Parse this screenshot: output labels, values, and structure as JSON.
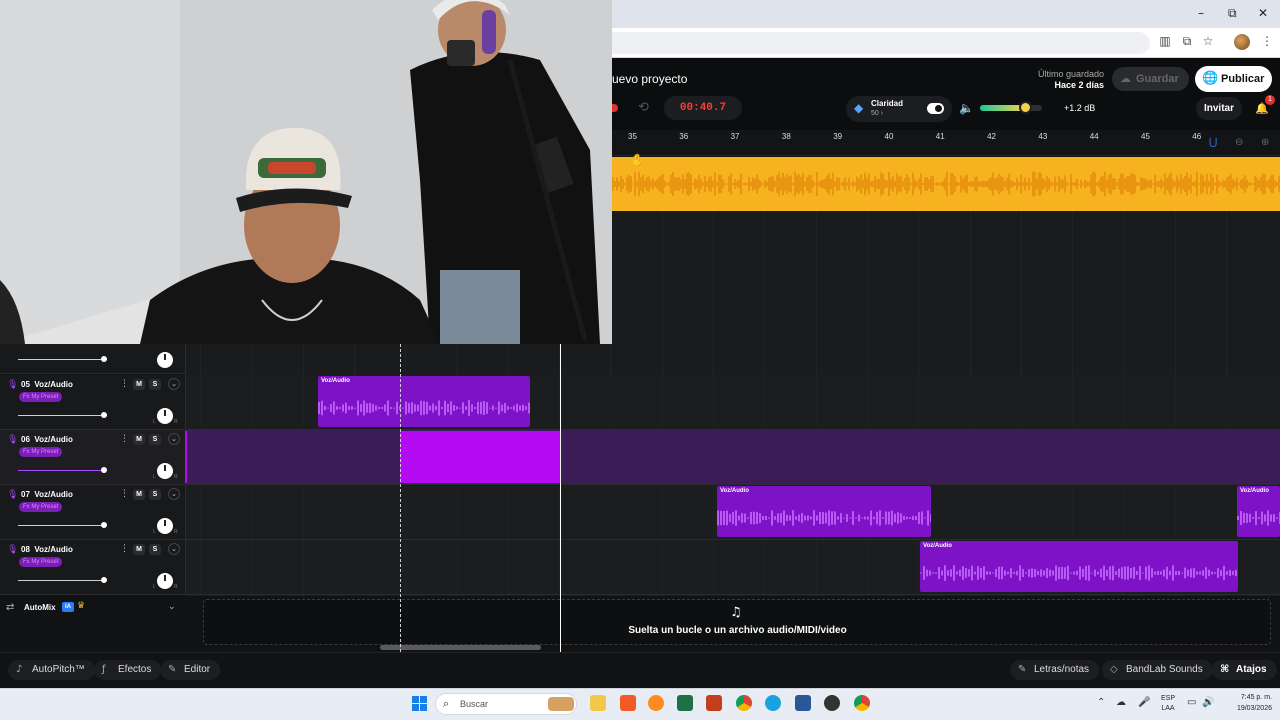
{
  "browser": {
    "minimize": "–",
    "restore": "⧉",
    "close": "✕"
  },
  "header": {
    "project_title": "uevo proyecto",
    "last_saved_label": "Último guardado",
    "last_saved_value": "Hace 2 días",
    "save_label": "Guardar",
    "publish_label": "Publicar",
    "time": "00:40.7",
    "clarity_label": "Claridad",
    "clarity_value": "50 ›",
    "volume_level": 0.73,
    "gain": "+1.2 dB",
    "invite_label": "Invitar",
    "notifications": "1"
  },
  "ruler": {
    "bars": [
      "35",
      "36",
      "37",
      "38",
      "39",
      "40",
      "41",
      "42",
      "43",
      "44",
      "45",
      "46"
    ]
  },
  "tracks": [
    {
      "number": "05",
      "name": "Voz/Audio",
      "fx": "Fx  My Preset",
      "mute": "M",
      "solo": "S",
      "volume": 0.98,
      "active": false,
      "clip_label": "Voz/Audio"
    },
    {
      "number": "06",
      "name": "Voz/Audio",
      "fx": "Fx  My Preset",
      "mute": "M",
      "solo": "S",
      "volume": 0.98,
      "active": true
    },
    {
      "number": "07",
      "name": "Voz/Audio",
      "fx": "Fx  My Preset",
      "mute": "M",
      "solo": "S",
      "volume": 0.98,
      "active": false,
      "clip_label": "Voz/Audio",
      "clip2_label": "Voz/Audio"
    },
    {
      "number": "08",
      "name": "Voz/Audio",
      "fx": "Fx  My Preset",
      "mute": "M",
      "solo": "S",
      "volume": 0.98,
      "active": false,
      "clip_label": "Voz/Audio"
    }
  ],
  "pan": {
    "left": "L",
    "right": "R"
  },
  "automix": {
    "label": "AutoMix",
    "badge": "IA"
  },
  "dropzone": {
    "text": "Suelta un bucle o un archivo audio/MIDI/video"
  },
  "toolbar": {
    "autopitch": "AutoPitch™",
    "effects": "Efectos",
    "editor": "Editor",
    "lyrics": "Letras/notas",
    "sounds": "BandLab Sounds",
    "shortcuts": "Atajos"
  },
  "taskbar": {
    "search_placeholder": "Buscar",
    "lang_top": "ESP",
    "lang_bottom": "LAA",
    "time": "7:45 p. m.",
    "date": "19/03/2026"
  },
  "colors": {
    "accent_purple": "#7d12c7",
    "accent_gold": "#f7b21f",
    "record_red": "#ff3b36"
  }
}
